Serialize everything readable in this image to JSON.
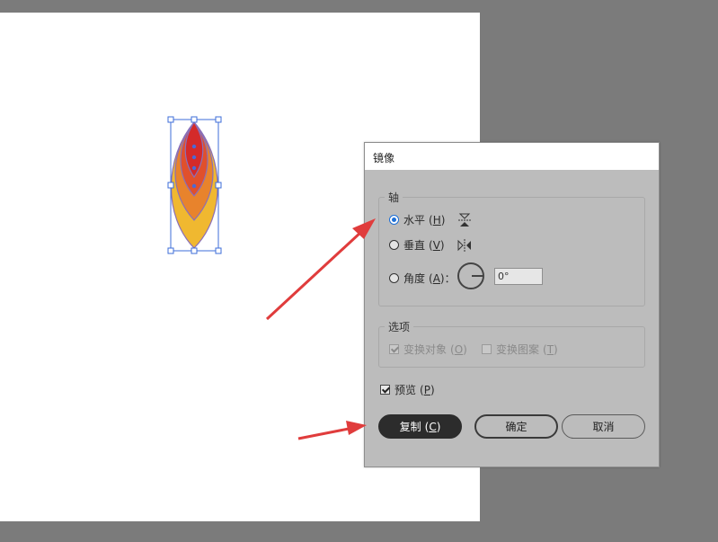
{
  "dialog": {
    "title": "镜像",
    "axis_group": "轴",
    "horizontal": {
      "label": "水平",
      "key": "H",
      "selected": true
    },
    "vertical": {
      "label": "垂直",
      "key": "V",
      "selected": false
    },
    "angle": {
      "label": "角度",
      "key": "A",
      "value": "0°",
      "selected": false
    },
    "options_group": "选项",
    "transform_objects": {
      "label": "变换对象",
      "key": "O",
      "checked": true,
      "enabled": false
    },
    "transform_patterns": {
      "label": "变换图案",
      "key": "T",
      "checked": false,
      "enabled": false
    },
    "preview": {
      "label": "预览",
      "key": "P",
      "checked": true
    },
    "buttons": {
      "copy": "复制",
      "copy_key": "C",
      "ok": "确定",
      "cancel": "取消"
    }
  },
  "colors": {
    "canvas_bg": "#7b7b7b",
    "artboard": "#ffffff",
    "dialog_bg": "#bcbcbc",
    "selection": "#3d6dd8",
    "arrow": "#e03c3c",
    "petal_outer": "#f0b830",
    "petal_mid": "#e8832c",
    "petal_inner": "#e0502c",
    "petal_core": "#d42a2a"
  },
  "icons": {
    "horizontal_axis": "flip-horizontal-axis-icon",
    "vertical_axis": "flip-vertical-axis-icon",
    "angle_dial": "angle-dial-icon"
  }
}
